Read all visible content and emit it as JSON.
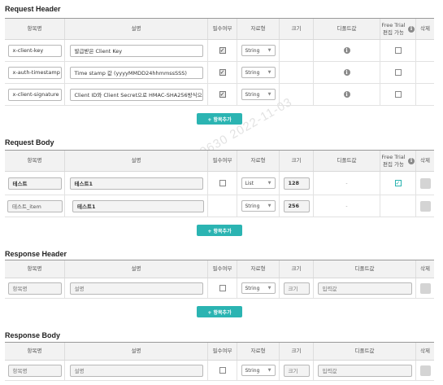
{
  "watermark": "10630 2022-11-03",
  "request_header": {
    "title": "Request Header",
    "columns": [
      "항목명",
      "설명",
      "필수여부",
      "자료형",
      "크기",
      "디폴트값",
      "Free Trial 편집 가능",
      "삭제"
    ],
    "rows": [
      {
        "name": "x-client-key",
        "desc": "발급받은 Client Key",
        "type": "String"
      },
      {
        "name": "x-auth-timestamp",
        "desc": "Time stamp 값 (yyyyMMDD24hhmmssSSS)",
        "type": "String"
      },
      {
        "name": "x-client-signature",
        "desc": "Client ID와 Client Secret으로 HMAC-SHA256방식으로",
        "type": "String"
      }
    ],
    "add_label": "+ 항목추가"
  },
  "request_body": {
    "title": "Request Body",
    "columns": [
      "항목명",
      "설명",
      "필수여부",
      "자료형",
      "크기",
      "디폴트값",
      "Free Trial 편집 가능",
      "삭제"
    ],
    "rows": [
      {
        "name": "테스트",
        "desc": "테스트1",
        "type": "List",
        "size": "128",
        "default": "-"
      },
      {
        "name": "테스트_item",
        "desc": "테스트1",
        "type": "String",
        "size": "256",
        "default": "-"
      }
    ],
    "add_label": "+ 항목추가"
  },
  "response_header": {
    "title": "Response Header",
    "columns": [
      "항목명",
      "설명",
      "필수여부",
      "자료형",
      "크기",
      "디폴트값",
      "삭제"
    ],
    "row": {
      "name_ph": "항목명",
      "desc_ph": "설명",
      "type": "String",
      "size_ph": "크기",
      "default_ph": "입력값"
    },
    "add_label": "+ 항목추가"
  },
  "response_body": {
    "title": "Response Body",
    "columns": [
      "항목명",
      "설명",
      "필수여부",
      "자료형",
      "크기",
      "디폴트값",
      "삭제"
    ],
    "row": {
      "name_ph": "항목명",
      "desc_ph": "설명",
      "type": "String",
      "size_ph": "크기",
      "default_ph": "입력값"
    }
  },
  "icons": {
    "info": "info-icon",
    "caret": "chevron-down-icon",
    "delete": "delete-button"
  },
  "colors": {
    "accent": "#2bb4b2",
    "header_bg": "#f2f2f2"
  }
}
